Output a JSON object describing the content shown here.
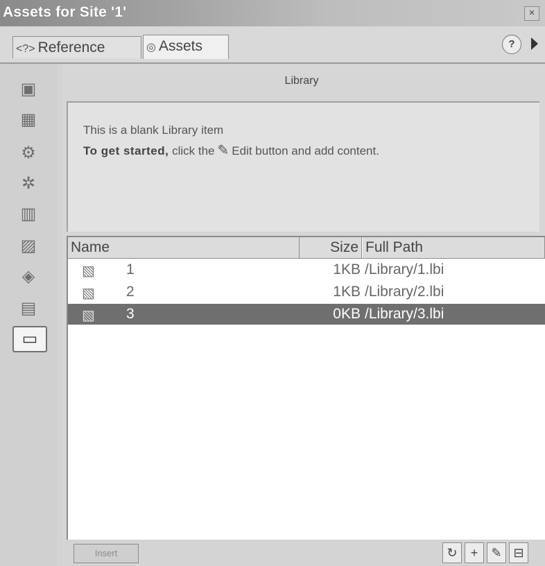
{
  "window": {
    "title": "Assets for Site '1'",
    "close_label": "×"
  },
  "tabs": [
    {
      "label": "Reference",
      "icon": "reference-icon",
      "glyph": "<?>"
    },
    {
      "label": "Assets",
      "icon": "assets-icon",
      "glyph": "◎"
    }
  ],
  "toolbar": {
    "help_label": "?"
  },
  "sidebar": {
    "items": [
      {
        "icon": "images-icon",
        "glyph": "▣"
      },
      {
        "icon": "colors-icon",
        "glyph": "▦"
      },
      {
        "icon": "urls-icon",
        "glyph": "⚙"
      },
      {
        "icon": "flash-icon",
        "glyph": "✲"
      },
      {
        "icon": "shockwave-icon",
        "glyph": "▥"
      },
      {
        "icon": "movies-icon",
        "glyph": "▨"
      },
      {
        "icon": "scripts-icon",
        "glyph": "◈"
      },
      {
        "icon": "templates-icon",
        "glyph": "▤"
      },
      {
        "icon": "library-icon",
        "glyph": "▭",
        "active": true
      }
    ]
  },
  "panel": {
    "title": "Library",
    "preview": {
      "line1": "This is a blank Library item",
      "line2_bold": "To get started,",
      "line2_pre": " click the",
      "line2_post": "Edit button and add content."
    },
    "columns": {
      "name": "Name",
      "size": "Size",
      "path": "Full Path"
    },
    "rows": [
      {
        "name": "1",
        "size": "1KB",
        "path": "/Library/1.lbi",
        "selected": false
      },
      {
        "name": "2",
        "size": "1KB",
        "path": "/Library/2.lbi",
        "selected": false
      },
      {
        "name": "3",
        "size": "0KB",
        "path": "/Library/3.lbi",
        "selected": true
      }
    ]
  },
  "bottom": {
    "insert_label": "Insert",
    "refresh": "↻",
    "new": "+",
    "edit": "✎",
    "delete": "⊟"
  }
}
